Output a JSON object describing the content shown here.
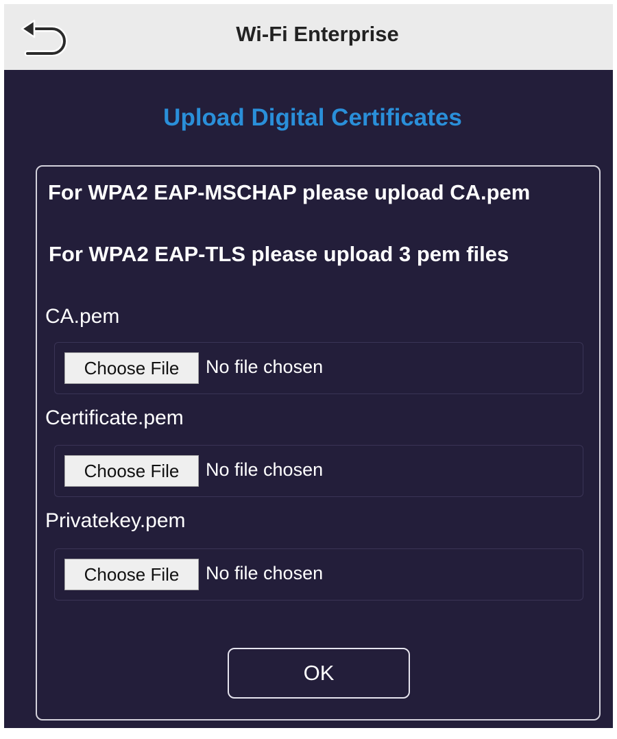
{
  "header": {
    "back_icon": "back-arrow-icon",
    "title": "Wi-Fi Enterprise"
  },
  "main": {
    "section_title": "Upload Digital Certificates",
    "notes": [
      "For WPA2 EAP-MSCHAP please upload CA.pem",
      "For WPA2 EAP-TLS please upload 3 pem files"
    ],
    "files": [
      {
        "label": "CA.pem",
        "button": "Choose File",
        "status": "No file chosen"
      },
      {
        "label": "Certificate.pem",
        "button": "Choose File",
        "status": "No file chosen"
      },
      {
        "label": "Privatekey.pem",
        "button": "Choose File",
        "status": "No file chosen"
      }
    ],
    "ok_label": "OK"
  },
  "colors": {
    "header_bg": "#ebebeb",
    "main_bg": "#231e3a",
    "accent": "#2a8fd9",
    "text": "#ffffff"
  }
}
